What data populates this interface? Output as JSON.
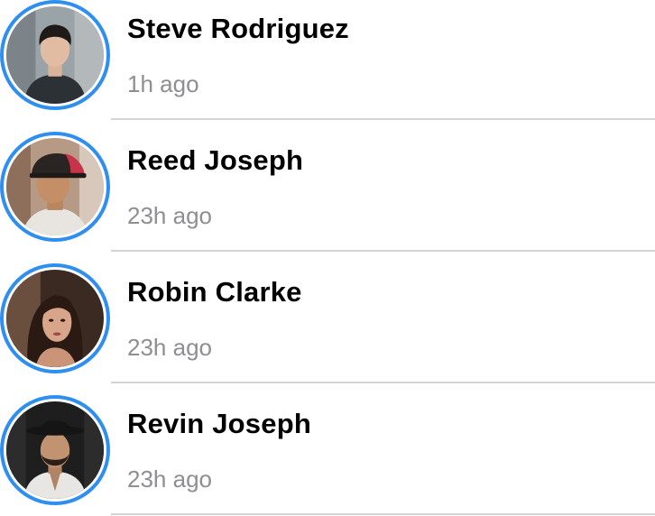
{
  "stories": [
    {
      "name": "Steve Rodriguez",
      "time": "1h ago"
    },
    {
      "name": "Reed Joseph",
      "time": "23h ago"
    },
    {
      "name": "Robin Clarke",
      "time": "23h ago"
    },
    {
      "name": "Revin Joseph",
      "time": "23h ago"
    }
  ],
  "colors": {
    "ring": "#2e8ff0",
    "name_text": "#000000",
    "time_text": "#8e8e93",
    "divider": "#d4d4d6"
  }
}
